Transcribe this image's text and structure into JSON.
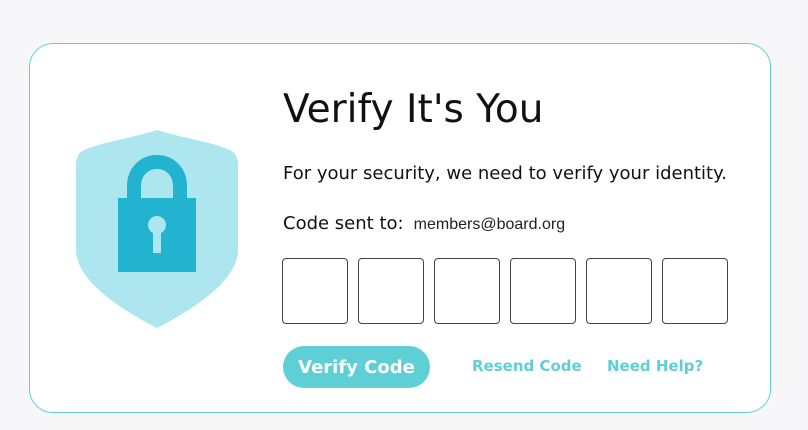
{
  "header": {
    "title": "Verify It's You",
    "subtitle": "For your security, we need to verify your identity."
  },
  "code_sent": {
    "label": "Code sent to:",
    "email": "members@board.org"
  },
  "code_inputs": {
    "digit_1": "",
    "digit_2": "",
    "digit_3": "",
    "digit_4": "",
    "digit_5": "",
    "digit_6": ""
  },
  "actions": {
    "verify_label": "Verify Code",
    "resend_label": "Resend Code",
    "help_label": "Need Help?"
  },
  "icons": {
    "shield": "shield-icon",
    "lock": "lock-icon"
  },
  "colors": {
    "accent": "#5fcfd6",
    "shield_fill": "#ade6ef",
    "lock_fill": "#22b3d0",
    "card_border": "#62cfd8",
    "text": "#111111"
  }
}
